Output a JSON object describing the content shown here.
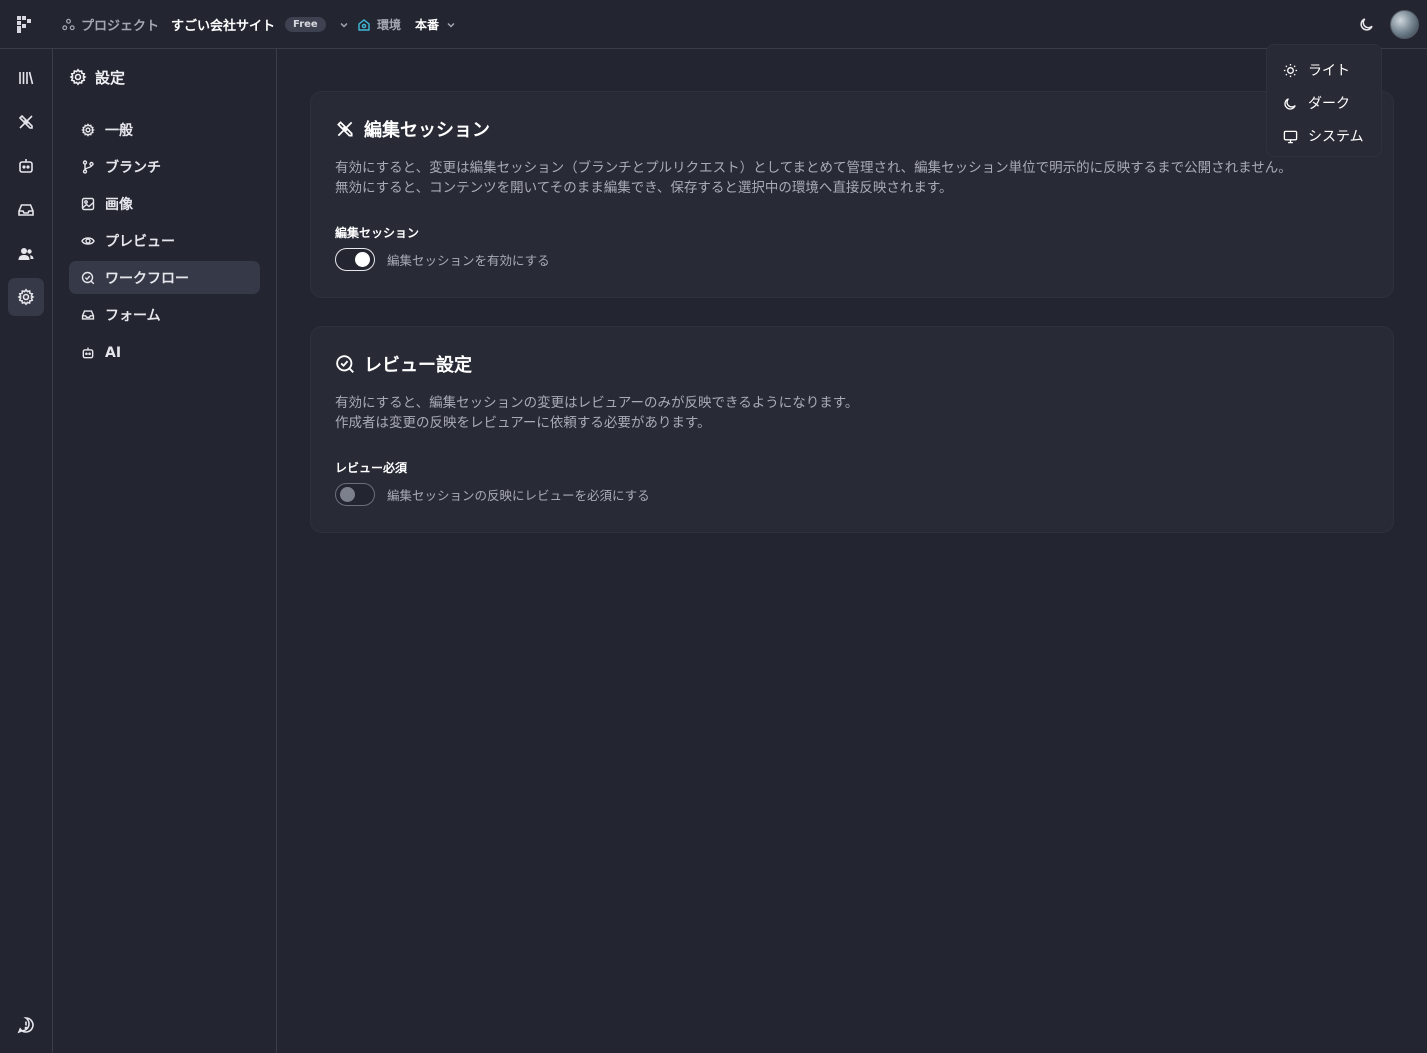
{
  "header": {
    "project_label": "プロジェクト",
    "project_name": "すごい会社サイト",
    "plan_badge": "Free",
    "env_label": "環境",
    "env_value": "本番"
  },
  "theme_menu": {
    "items": [
      {
        "label": "ライト",
        "icon": "sun-icon"
      },
      {
        "label": "ダーク",
        "icon": "moon-icon"
      },
      {
        "label": "システム",
        "icon": "monitor-icon"
      }
    ]
  },
  "rail": {
    "items": [
      "library-icon",
      "compose-icon",
      "bot-icon",
      "inbox-icon",
      "users-icon",
      "settings-icon"
    ],
    "active_index": 5,
    "footer_icon": "feedback-icon"
  },
  "sidebar": {
    "title": "設定",
    "items": [
      {
        "label": "一般",
        "icon": "gear-icon"
      },
      {
        "label": "ブランチ",
        "icon": "branch-icon"
      },
      {
        "label": "画像",
        "icon": "image-icon"
      },
      {
        "label": "プレビュー",
        "icon": "eye-icon"
      },
      {
        "label": "ワークフロー",
        "icon": "workflow-check-icon"
      },
      {
        "label": "フォーム",
        "icon": "inbox-icon"
      },
      {
        "label": "AI",
        "icon": "bot-icon"
      }
    ],
    "active_index": 4
  },
  "cards": [
    {
      "title": "編集セッション",
      "description_lines": [
        "有効にすると、変更は編集セッション（ブランチとプルリクエスト）としてまとめて管理され、編集セッション単位で明示的に反映するまで公開されません。",
        "無効にすると、コンテンツを開いてそのまま編集でき、保存すると選択中の環境へ直接反映されます。"
      ],
      "field_label": "編集セッション",
      "toggle_label": "編集セッションを有効にする",
      "toggle_on": true
    },
    {
      "title": "レビュー設定",
      "description_lines": [
        "有効にすると、編集セッションの変更はレビュアーのみが反映できるようになります。",
        "作成者は変更の反映をレビュアーに依頼する必要があります。"
      ],
      "field_label": "レビュー必須",
      "toggle_label": "編集セッションの反映にレビューを必須にする",
      "toggle_on": false
    }
  ],
  "colors": {
    "background": "#232530",
    "card": "#282a35",
    "active_item": "#363947",
    "env_accent": "#3fb8d8"
  }
}
